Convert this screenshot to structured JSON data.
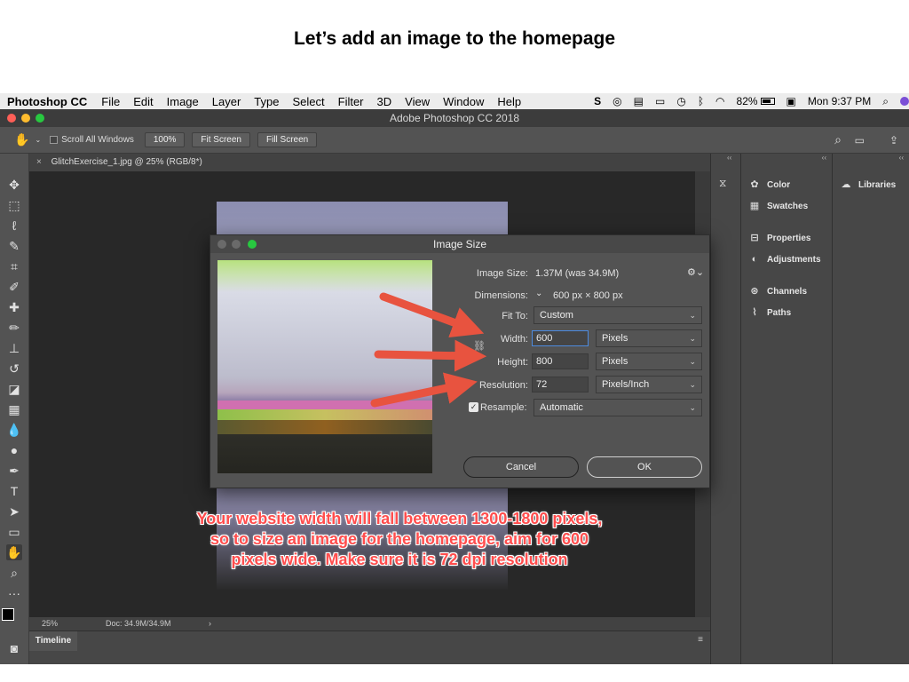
{
  "slide": {
    "title": "Let’s add an image to the homepage"
  },
  "menubar": {
    "app": "Photoshop CC",
    "items": [
      "File",
      "Edit",
      "Image",
      "Layer",
      "Type",
      "Select",
      "Filter",
      "3D",
      "View",
      "Window",
      "Help"
    ],
    "battery": "82%",
    "clock": "Mon 9:37 PM"
  },
  "window": {
    "title": "Adobe Photoshop CC 2018"
  },
  "options": {
    "scroll_all": "Scroll All Windows",
    "zoom_btn": "100%",
    "fit_btn": "Fit Screen",
    "fill_btn": "Fill Screen"
  },
  "document": {
    "tab": "GlitchExercise_1.jpg @ 25% (RGB/8*)",
    "zoom": "25%",
    "doc_size": "Doc: 34.9M/34.9M"
  },
  "timeline": {
    "label": "Timeline"
  },
  "panels": {
    "col1": [
      "Color",
      "Swatches",
      "Properties",
      "Adjustments",
      "Channels",
      "Paths"
    ],
    "col2": [
      "Libraries"
    ]
  },
  "dialog": {
    "title": "Image Size",
    "image_size_label": "Image Size:",
    "image_size_value": "1.37M (was 34.9M)",
    "dimensions_label": "Dimensions:",
    "dimensions_value": "600 px  ×  800 px",
    "fit_to_label": "Fit To:",
    "fit_to_value": "Custom",
    "width_label": "Width:",
    "width_value": "600",
    "width_unit": "Pixels",
    "height_label": "Height:",
    "height_value": "800",
    "height_unit": "Pixels",
    "resolution_label": "Resolution:",
    "resolution_value": "72",
    "resolution_unit": "Pixels/Inch",
    "resample_label": "Resample:",
    "resample_value": "Automatic",
    "cancel": "Cancel",
    "ok": "OK"
  },
  "annotation": {
    "line1": "Your website width will fall between 1300-1800 pixels,",
    "line2": "so to size an image for the homepage, aim for 600",
    "line3": "pixels wide. Make sure it is 72 dpi resolution"
  },
  "colors": {
    "arrow": "#e8533f",
    "caption": "#ff4d4d",
    "dialog_bg": "#535353"
  }
}
